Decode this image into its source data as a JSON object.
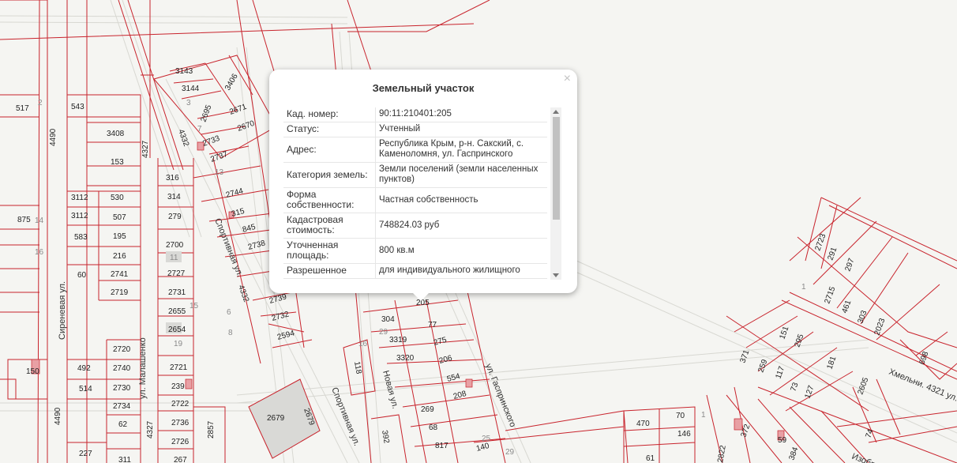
{
  "map": {
    "parcel_labels": [
      "517",
      "543",
      "3408",
      "153",
      "4490",
      "3112",
      "530",
      "3112",
      "507",
      "875",
      "583",
      "195",
      "216",
      "60",
      "2741",
      "2719",
      "2720",
      "2740",
      "492",
      "514",
      "2730",
      "2734",
      "62",
      "2736",
      "2726",
      "227",
      "311",
      "267",
      "150",
      "4490",
      "4327",
      "4327",
      "316",
      "314",
      "279",
      "2700",
      "2727",
      "2731",
      "2655",
      "2654",
      "2721",
      "239",
      "2722",
      "2857",
      "3143",
      "3144",
      "2695",
      "3406",
      "2671",
      "2670",
      "2733",
      "2737",
      "4332",
      "4332",
      "2744",
      "315",
      "845",
      "2738",
      "2739",
      "2732",
      "2594",
      "304",
      "3319",
      "77",
      "3320",
      "275",
      "206",
      "554",
      "208",
      "269",
      "68",
      "817",
      "140",
      "392",
      "118",
      "205",
      "2723",
      "291",
      "297",
      "2715",
      "461",
      "303",
      "2023",
      "371",
      "259",
      "117",
      "73",
      "151",
      "295",
      "181",
      "127",
      "2605",
      "698",
      "372",
      "59",
      "384",
      "74",
      "470",
      "70",
      "146",
      "61",
      "2679",
      "2679",
      "2822"
    ],
    "gray_labels": [
      "14",
      "16",
      "11",
      "15",
      "19",
      "13",
      "6",
      "8",
      "3",
      "7",
      "2",
      "1",
      "16",
      "29",
      "29",
      "25",
      "1"
    ],
    "streets": [
      "Сиреневая ул.",
      "ул. Малашенко",
      "Спортивная ул.",
      "Спортивная ул.",
      "Новая ул.",
      "ул. Гаспринского",
      "Хмельни. 4321 ул.",
      "Изобр"
    ]
  },
  "popup": {
    "title": "Земельный участок",
    "close_label": "×",
    "rows": [
      {
        "key": "Кад. номер:",
        "value": "90:11:210401:205"
      },
      {
        "key": "Статус:",
        "value": "Учтенный"
      },
      {
        "key": "Адрес:",
        "value": "Республика Крым, р-н. Сакский, с. Каменоломня, ул. Гаспринского"
      },
      {
        "key": "Категория земель:",
        "value": "Земли поселений (земли населенных пунктов)"
      },
      {
        "key": "Форма собственности:",
        "value": "Частная собственность"
      },
      {
        "key": "Кадастровая стоимость:",
        "value": "748824.03 руб"
      },
      {
        "key": "Уточненная площадь:",
        "value": "800 кв.м"
      },
      {
        "key": "Разрешенное",
        "value": "для индивидуального жилищного"
      }
    ]
  },
  "colors": {
    "parcel": "#c8232c",
    "background": "#f5f5f2",
    "road": "#e6e6e0"
  }
}
